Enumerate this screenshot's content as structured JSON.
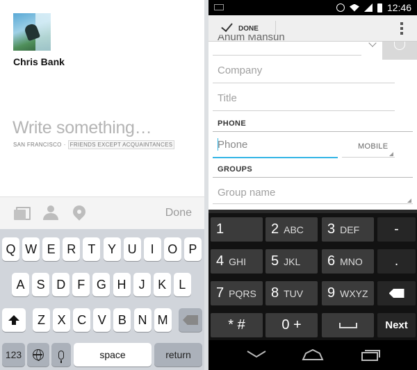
{
  "composer": {
    "user_name": "Chris Bank",
    "placeholder": "Write something…",
    "location": "SAN FRANCISCO",
    "separator": "·",
    "audience": "FRIENDS EXCEPT ACQUAINTANCES",
    "done_label": "Done",
    "toolbar_icons": [
      "photos-icon",
      "person-icon",
      "place-icon"
    ]
  },
  "ios_keyboard": {
    "row1": [
      "Q",
      "W",
      "E",
      "R",
      "T",
      "Y",
      "U",
      "I",
      "O",
      "P"
    ],
    "row2": [
      "A",
      "S",
      "D",
      "F",
      "G",
      "H",
      "J",
      "K",
      "L"
    ],
    "row3": [
      "Z",
      "X",
      "C",
      "V",
      "B",
      "N",
      "M"
    ],
    "numbers_label": "123",
    "space_label": "space",
    "return_label": "return"
  },
  "android": {
    "status_time": "12:46",
    "done_label": "DONE",
    "name_value": "Anum Mansun",
    "company_placeholder": "Company",
    "title_placeholder": "Title",
    "phone_section": "PHONE",
    "phone_placeholder": "Phone",
    "phone_type": "MOBILE",
    "groups_section": "GROUPS",
    "group_placeholder": "Group name"
  },
  "android_keyboard": {
    "keys": [
      {
        "n": "1",
        "l": ""
      },
      {
        "n": "2",
        "l": "ABC"
      },
      {
        "n": "3",
        "l": "DEF"
      },
      {
        "n": "-",
        "l": ""
      },
      {
        "n": "4",
        "l": "GHI"
      },
      {
        "n": "5",
        "l": "JKL"
      },
      {
        "n": "6",
        "l": "MNO"
      },
      {
        "n": ".",
        "l": ""
      },
      {
        "n": "7",
        "l": "PQRS"
      },
      {
        "n": "8",
        "l": "TUV"
      },
      {
        "n": "9",
        "l": "WXYZ"
      },
      {
        "n": "",
        "l": ""
      },
      {
        "n": "* #",
        "l": ""
      },
      {
        "n": "0 +",
        "l": ""
      },
      {
        "n": "␣",
        "l": ""
      },
      {
        "n": "Next",
        "l": ""
      }
    ]
  },
  "colors": {
    "focus_underline": "#33b5e5",
    "ios_kb_bg": "#d1d5db",
    "android_kb_bg": "#121212"
  }
}
